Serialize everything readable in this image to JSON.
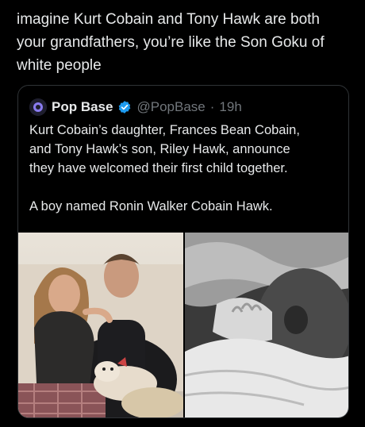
{
  "tweet": {
    "text": "imagine Kurt Cobain and Tony Hawk are both\nyour grandfathers, you’re like the Son Goku of\nwhite people"
  },
  "quoted_tweet": {
    "display_name": "Pop Base",
    "handle": "@PopBase",
    "separator": "·",
    "time": "19h",
    "body": "Kurt Cobain’s daughter, Frances Bean Cobain,\nand Tony Hawk’s son, Riley Hawk, announce\nthey have welcomed their first child together.\n\nA boy named Ronin Walker Cobain Hawk.",
    "verified_icon": "verified-badge-icon",
    "media": [
      {
        "kind": "color-photo",
        "subject": "couple-on-couch-with-dog"
      },
      {
        "kind": "bw-photo",
        "subject": "newborn-close-up"
      }
    ]
  },
  "colors": {
    "background": "#000000",
    "text": "#e7e9ea",
    "muted": "#71767b",
    "border": "#2f3336",
    "verified": "#1d9bf0"
  }
}
